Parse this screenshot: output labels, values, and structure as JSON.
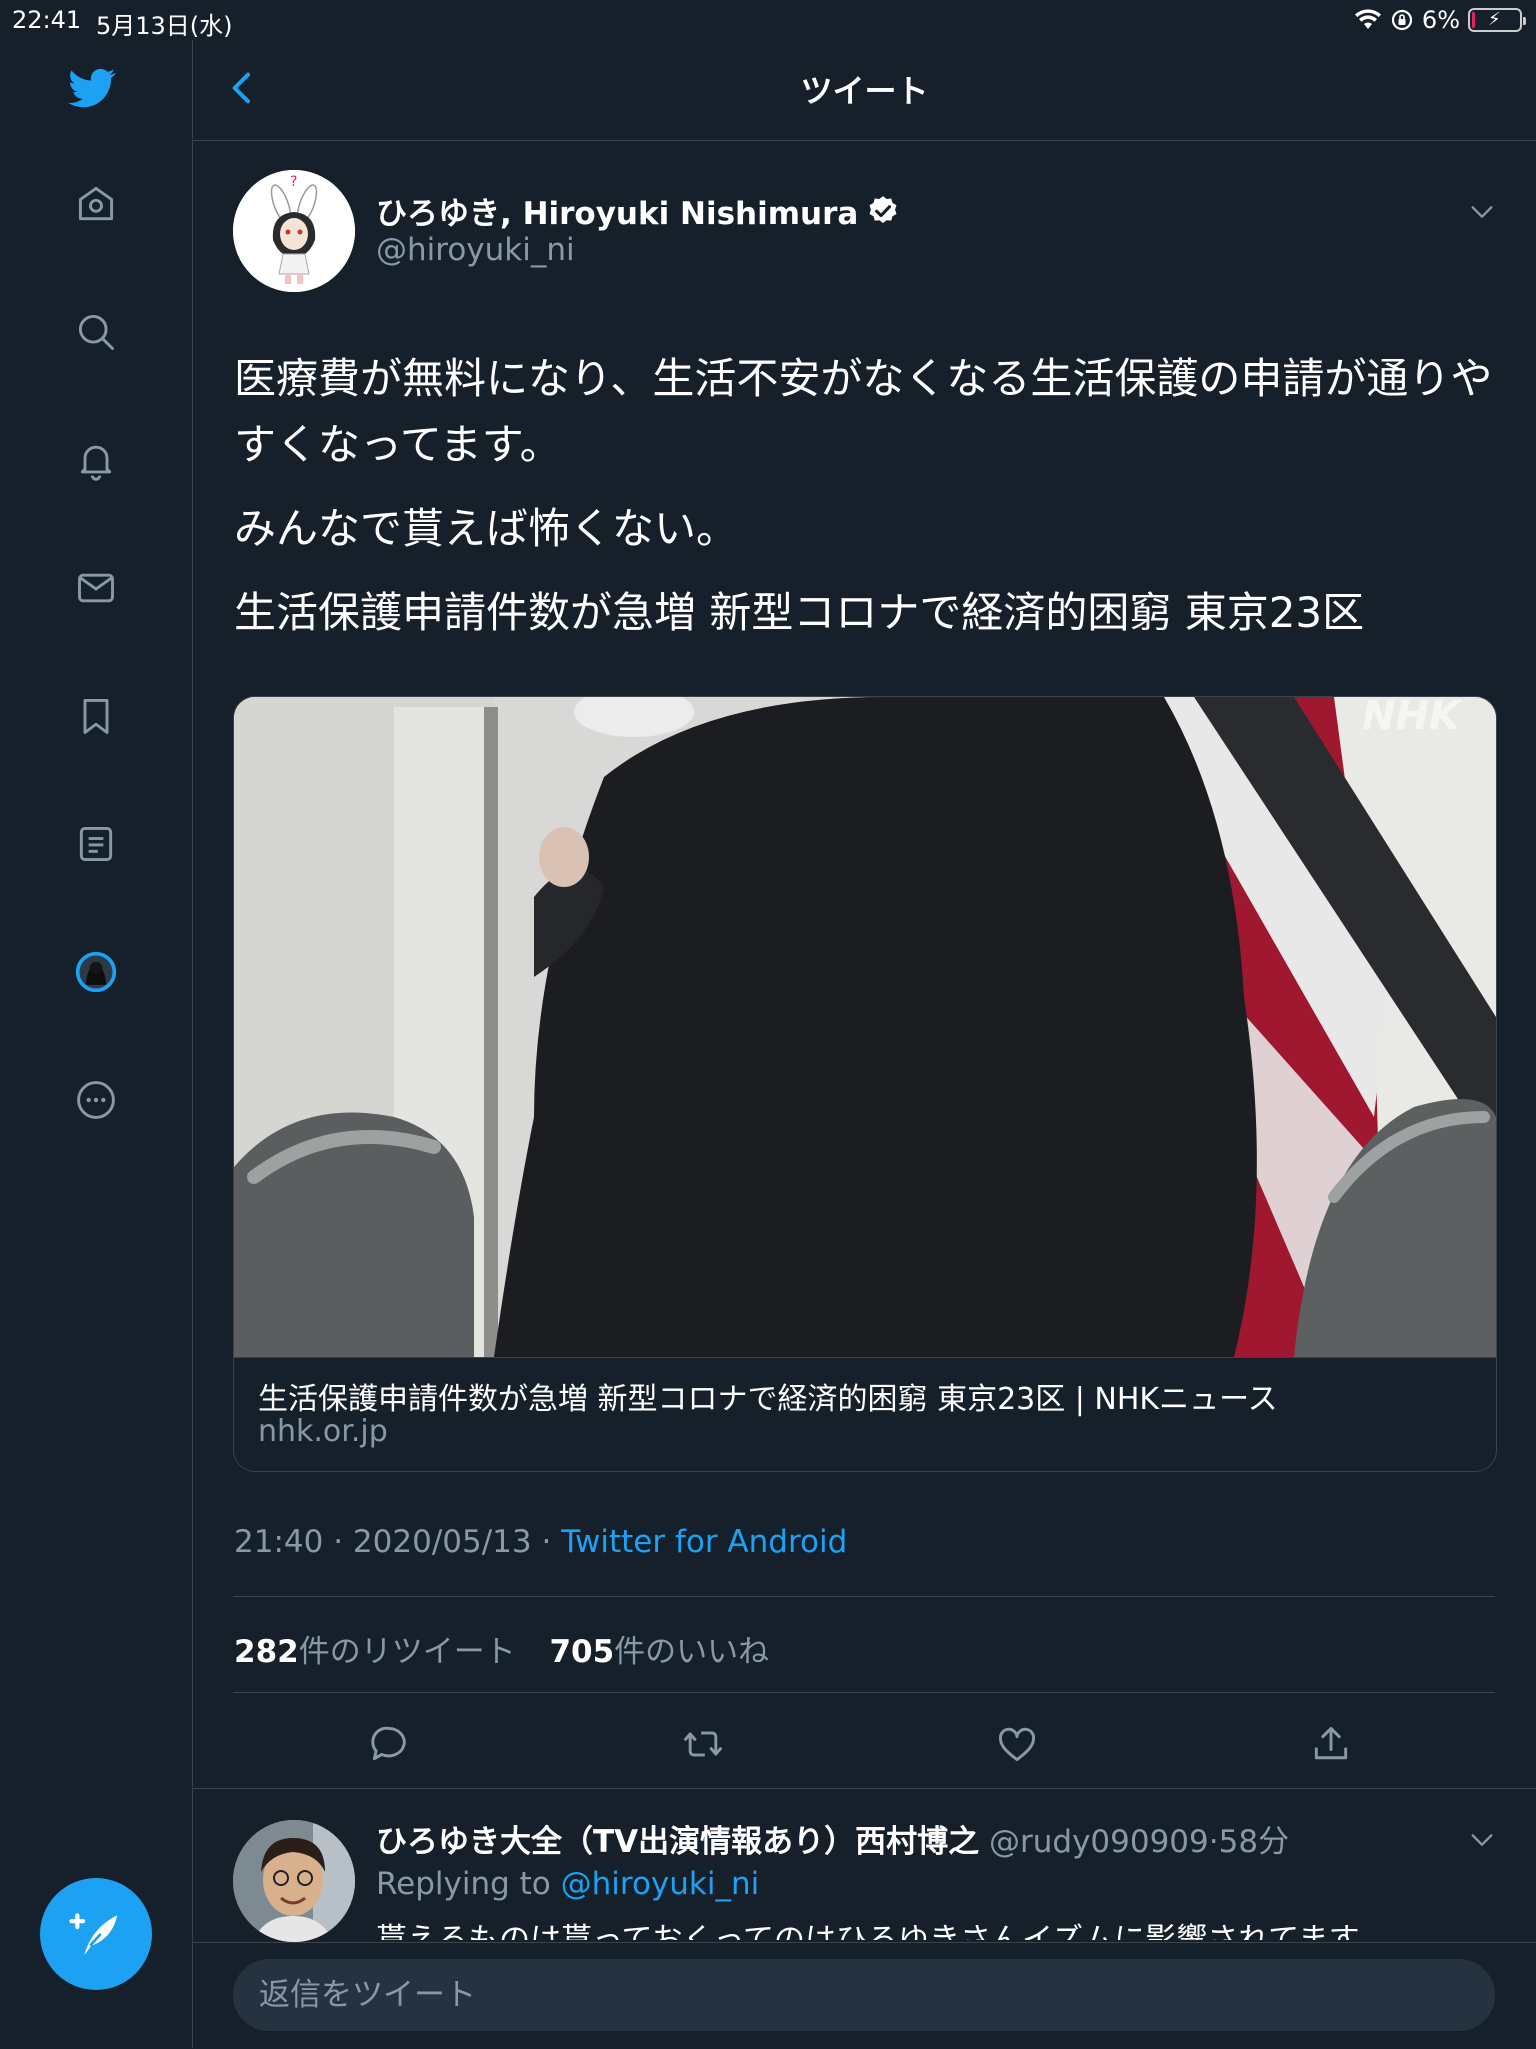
{
  "status_bar": {
    "time": "22:41",
    "date": "5月13日(水)",
    "battery": "6%",
    "battery_level": 0.06
  },
  "header": {
    "title": "ツイート"
  },
  "tweet": {
    "author_name": "ひろゆき, Hiroyuki Nishimura",
    "author_handle": "@hiroyuki_ni",
    "paragraphs": [
      "医療費が無料になり、生活不安がなくなる生活保護の申請が通りやすくなってます。",
      "みんなで貰えば怖くない。",
      "生活保護申請件数が急増 新型コロナで経済的困窮 東京23区"
    ],
    "card": {
      "title": "生活保護申請件数が急増 新型コロナで経済的困窮 東京23区 | NHKニュース",
      "domain": "nhk.or.jp",
      "watermark": "NHK"
    },
    "time": "21:40",
    "date": "2020/05/13",
    "source": "Twitter for Android",
    "retweets_count": "282",
    "retweets_label": "件のリツイート",
    "likes_count": "705",
    "likes_label": "件のいいね"
  },
  "reply": {
    "name": "ひろゆき大全（TV出演情報あり）西村博之",
    "handle": "@rudy090909",
    "age": "58分",
    "replying_prefix": "Replying to",
    "replying_handle": "@hiroyuki_ni",
    "snippet": "貰えるものは貰っておくってのはひろゆきさんイズムに影響されてます"
  },
  "reply_bar": {
    "placeholder": "返信をツイート"
  },
  "colors": {
    "background": "#15202b",
    "accent": "#1da1f2",
    "muted": "#8899a6",
    "border": "#38444d"
  }
}
